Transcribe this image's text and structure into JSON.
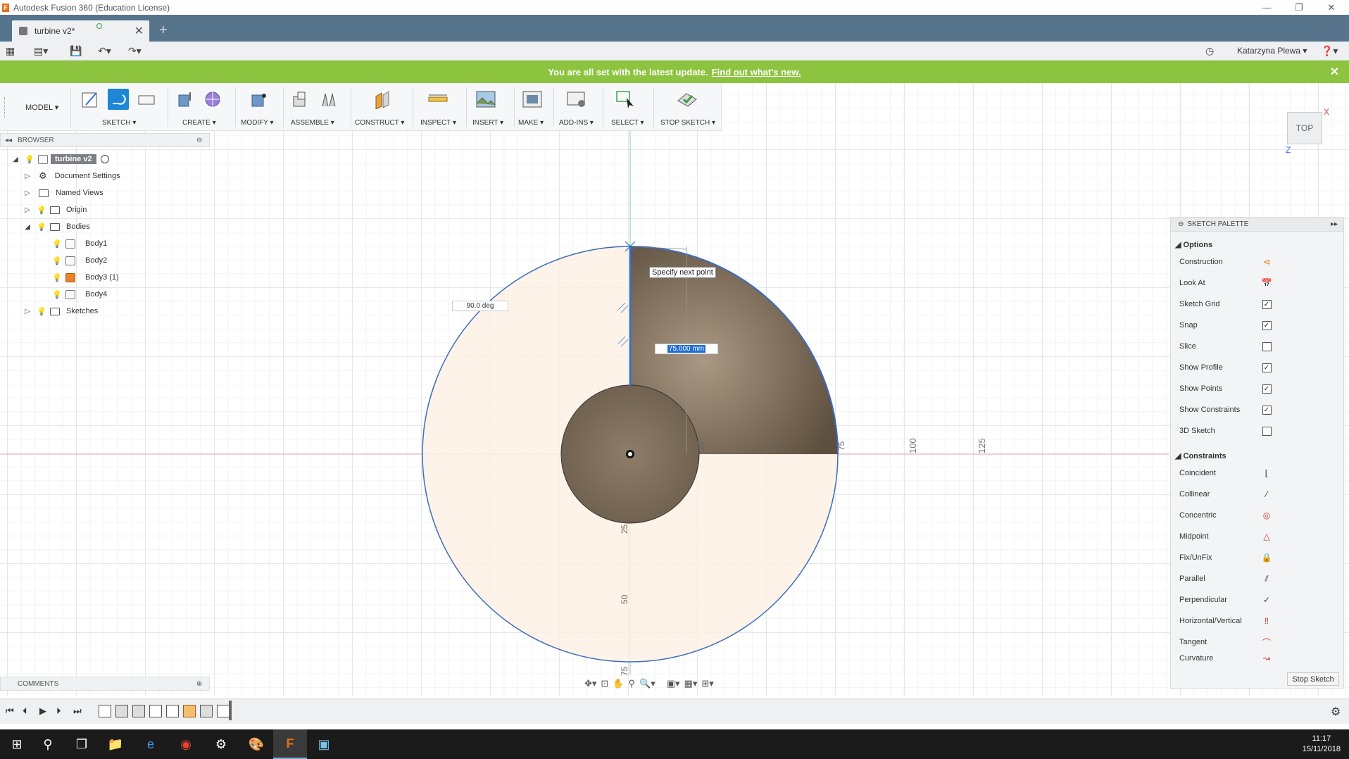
{
  "window": {
    "title": "Autodesk Fusion 360 (Education License)",
    "app_glyph": "F"
  },
  "tab": {
    "label": "turbine v2*"
  },
  "user": {
    "name": "Katarzyna Plewa ▾"
  },
  "banner": {
    "text": "You are all set with the latest update.",
    "link": "Find out what's new."
  },
  "toolbar": {
    "workspace": "MODEL ▾",
    "groups": [
      "SKETCH ▾",
      "CREATE ▾",
      "MODIFY ▾",
      "ASSEMBLE ▾",
      "CONSTRUCT ▾",
      "INSPECT ▾",
      "INSERT ▾",
      "MAKE ▾",
      "ADD-INS ▾",
      "SELECT ▾",
      "STOP SKETCH ▾"
    ]
  },
  "browser": {
    "title": "BROWSER",
    "root": "turbine v2",
    "items": [
      {
        "label": "Document Settings",
        "icon": "gear-icon"
      },
      {
        "label": "Named Views",
        "icon": "folder-icon"
      },
      {
        "label": "Origin",
        "icon": "folder-icon"
      },
      {
        "label": "Bodies",
        "icon": "folder-icon"
      },
      {
        "label": "Body1",
        "icon": "body-icon"
      },
      {
        "label": "Body2",
        "icon": "body-icon"
      },
      {
        "label": "Body3 (1)",
        "icon": "component-icon"
      },
      {
        "label": "Body4",
        "icon": "body-icon"
      },
      {
        "label": "Sketches",
        "icon": "folder-icon"
      }
    ]
  },
  "comments": {
    "title": "COMMENTS"
  },
  "canvas": {
    "tooltip": "Specify next point",
    "angle": "90.0 deg",
    "length": "75.000 mm",
    "axis_labels_x": [
      "25",
      "50",
      "75",
      "100",
      "125"
    ],
    "axis_labels_y": [
      "25",
      "50",
      "75"
    ]
  },
  "viewcube": {
    "face": "TOP",
    "axis_x": "X",
    "axis_z": "Z"
  },
  "palette": {
    "title": "SKETCH PALETTE",
    "options_title": "Options",
    "options": [
      {
        "label": "Construction",
        "kind": "icon",
        "icon": "construction-icon"
      },
      {
        "label": "Look At",
        "kind": "icon",
        "icon": "look-at-icon"
      },
      {
        "label": "Sketch Grid",
        "kind": "check",
        "checked": "✓"
      },
      {
        "label": "Snap",
        "kind": "check",
        "checked": "✓"
      },
      {
        "label": "Slice",
        "kind": "check",
        "checked": ""
      },
      {
        "label": "Show Profile",
        "kind": "check",
        "checked": "✓"
      },
      {
        "label": "Show Points",
        "kind": "check",
        "checked": "✓"
      },
      {
        "label": "Show Constraints",
        "kind": "check",
        "checked": "✓"
      },
      {
        "label": "3D Sketch",
        "kind": "check",
        "checked": ""
      }
    ],
    "constraints_title": "Constraints",
    "constraints": [
      "Coincident",
      "Collinear",
      "Concentric",
      "Midpoint",
      "Fix/UnFix",
      "Parallel",
      "Perpendicular",
      "Horizontal/Vertical",
      "Tangent",
      "Curvature"
    ],
    "stop_button": "Stop Sketch"
  },
  "clock": {
    "time": "11:17",
    "date": "15/11/2018"
  },
  "colors": {
    "banner": "#8cc43f",
    "tabbar": "#57748d",
    "accent": "#0a7fd4",
    "profile": "#fdf1e4",
    "body_shade": "#8a7a66"
  }
}
